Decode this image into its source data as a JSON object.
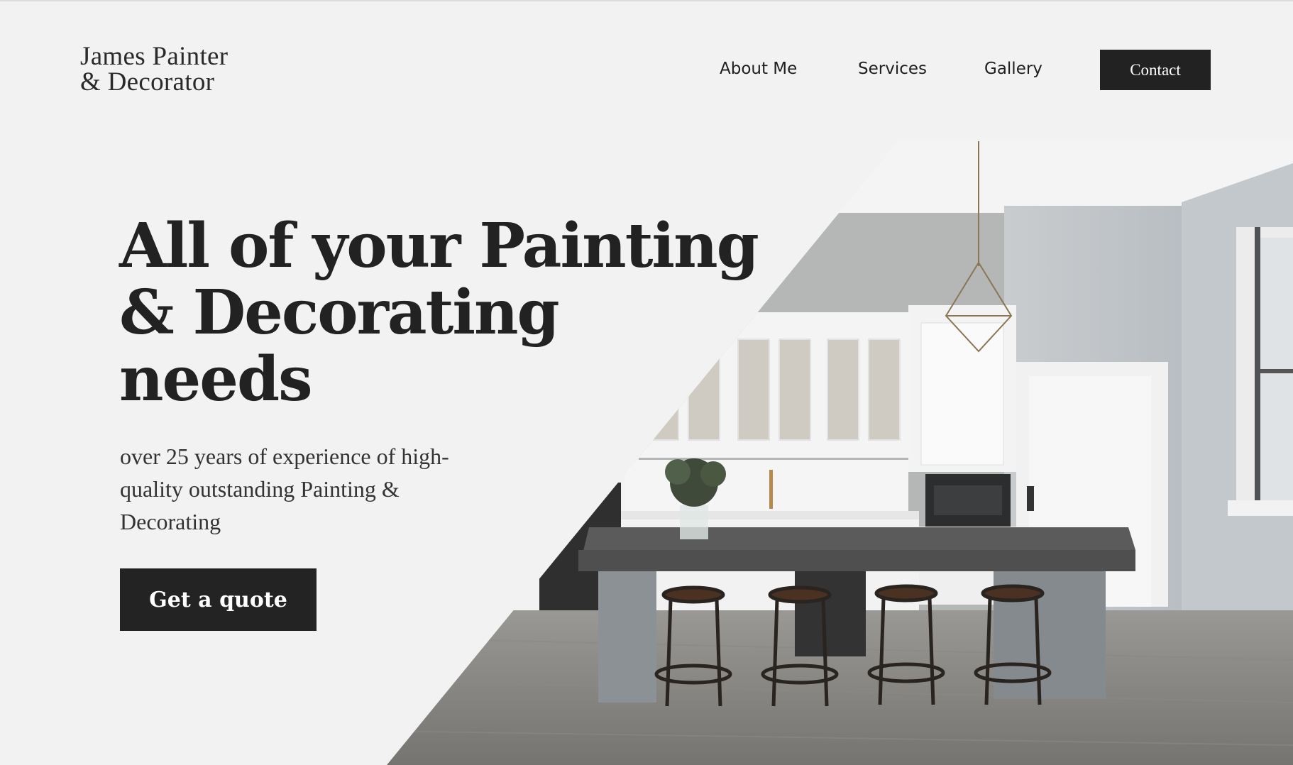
{
  "brand": {
    "line1": "James Painter",
    "line2": "& Decorator"
  },
  "nav": {
    "about": "About Me",
    "services": "Services",
    "gallery": "Gallery",
    "contact": "Contact"
  },
  "hero": {
    "headline": [
      "All of your Painting",
      "& Decorating",
      "needs"
    ],
    "subtext": [
      "over 25 years of experience of high-",
      "quality outstanding Painting &",
      "Decorating"
    ],
    "cta": "Get a quote",
    "image_desc": "kitchen-photo"
  },
  "colors": {
    "background": "#f2f2f2",
    "ink": "#232323",
    "button": "#222222",
    "button_text": "#ffffff"
  }
}
